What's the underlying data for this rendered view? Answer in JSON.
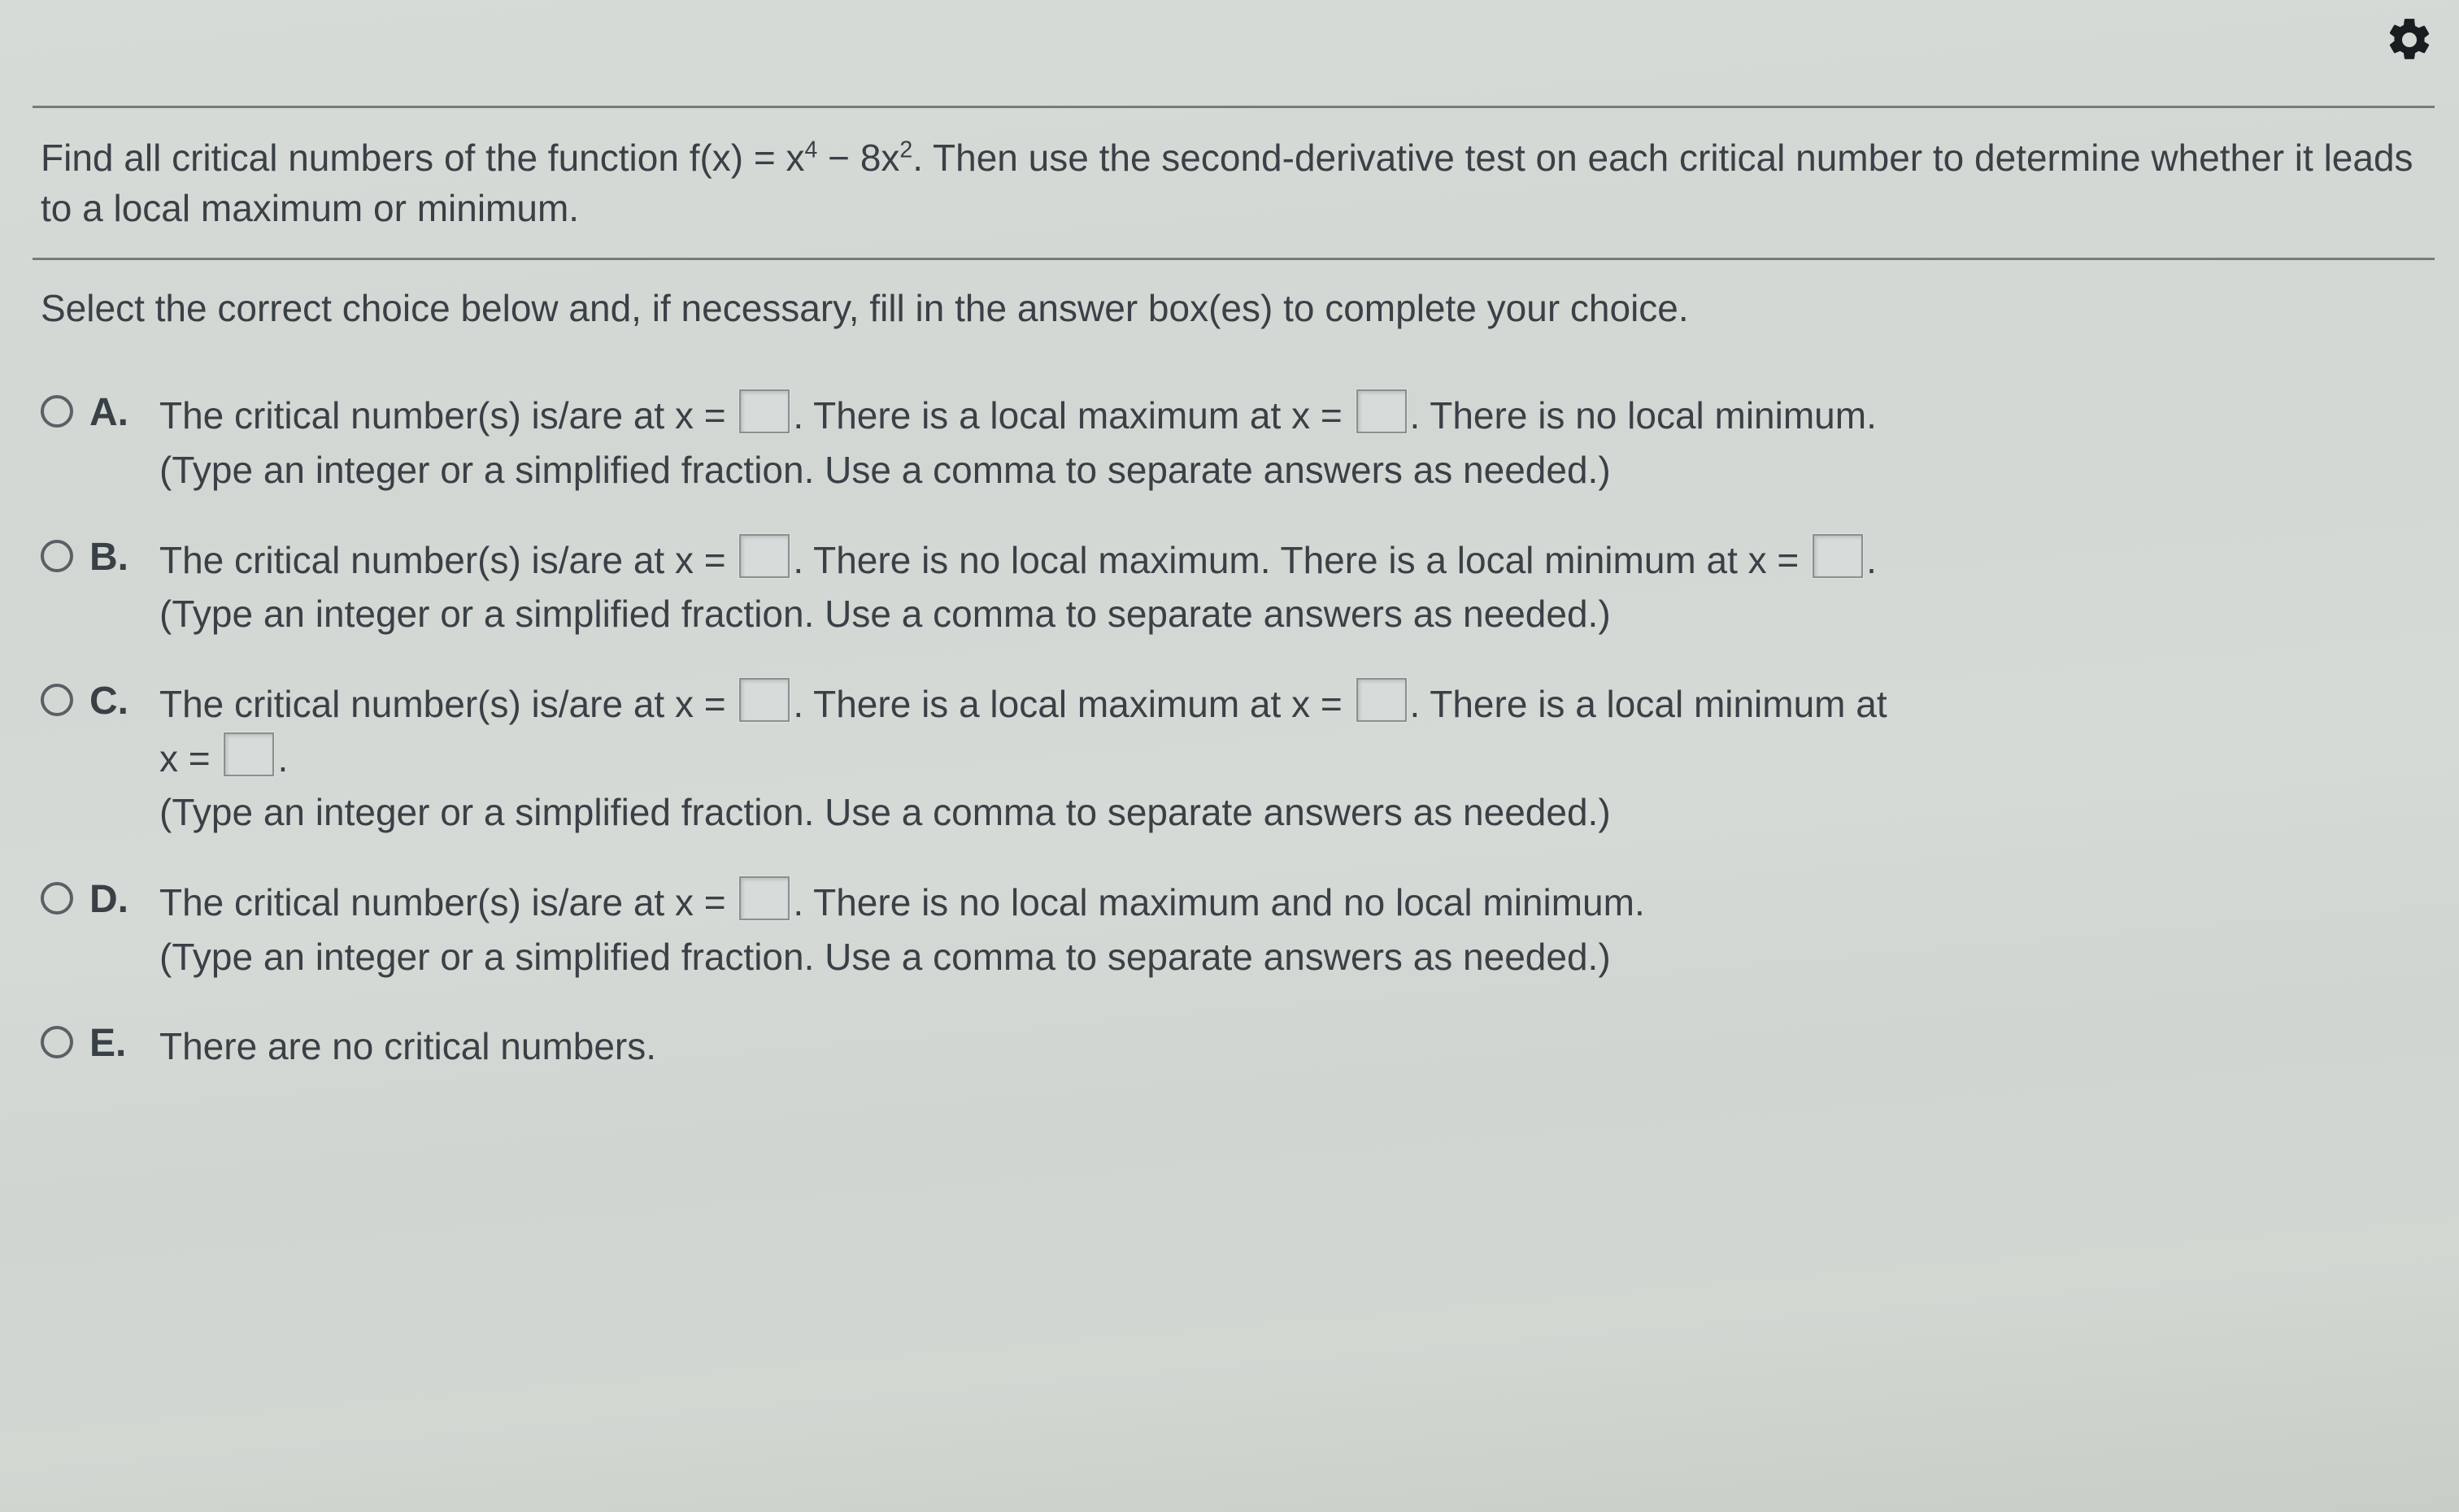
{
  "question": {
    "part1": "Find all critical numbers of the function f(x) = x",
    "exp1": "4",
    "part2": " − 8x",
    "exp2": "2",
    "part3": ". Then use the second-derivative test on each critical number to determine whether it leads to a local maximum or minimum."
  },
  "instruction": "Select the correct choice below and, if necessary, fill in the answer box(es) to complete your choice.",
  "hint": "(Type an integer or a simplified fraction. Use a comma to separate answers as needed.)",
  "choices": {
    "A": {
      "letter": "A.",
      "seg1": "The critical number(s) is/are at x = ",
      "seg2": ". There is a local maximum at x = ",
      "seg3": ". There is no local minimum."
    },
    "B": {
      "letter": "B.",
      "seg1": "The critical number(s) is/are at x = ",
      "seg2": ". There is no local maximum. There is a local minimum at x = ",
      "seg3": "."
    },
    "C": {
      "letter": "C.",
      "seg1": "The critical number(s) is/are at x = ",
      "seg2": ". There is a local maximum at x = ",
      "seg3": ". There is a local minimum at",
      "seg4": "x = ",
      "seg5": "."
    },
    "D": {
      "letter": "D.",
      "seg1": "The critical number(s) is/are at x = ",
      "seg2": ". There is no local maximum and no local minimum."
    },
    "E": {
      "letter": "E.",
      "text": "There are no critical numbers."
    }
  }
}
